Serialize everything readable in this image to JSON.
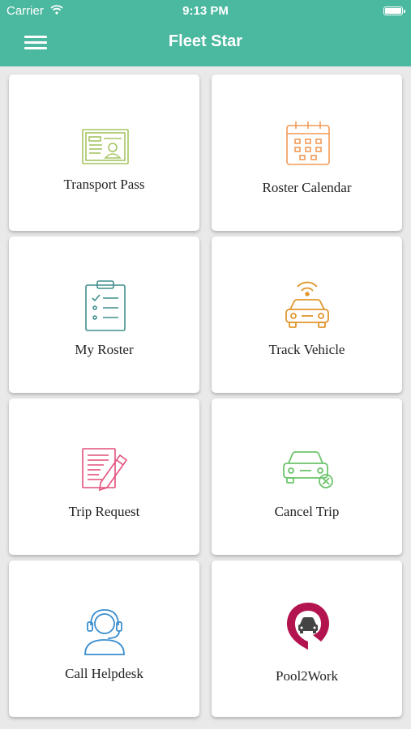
{
  "status_bar": {
    "carrier": "Carrier",
    "time": "9:13 PM"
  },
  "nav": {
    "title": "Fleet Star",
    "menu_icon": "hamburger-menu-icon"
  },
  "tiles": [
    {
      "label": "Transport Pass",
      "icon": "id-card-icon",
      "color": "#a5c563"
    },
    {
      "label": "Roster Calendar",
      "icon": "calendar-icon",
      "color": "#f29a56"
    },
    {
      "label": "My Roster",
      "icon": "clipboard-checklist-icon",
      "color": "#3f8f8c"
    },
    {
      "label": "Track Vehicle",
      "icon": "car-signal-icon",
      "color": "#e0962c"
    },
    {
      "label": "Trip Request",
      "icon": "document-pencil-icon",
      "color": "#e2507a"
    },
    {
      "label": "Cancel Trip",
      "icon": "car-cancel-icon",
      "color": "#6cc46c"
    },
    {
      "label": "Call Helpdesk",
      "icon": "headset-agent-icon",
      "color": "#3a8ecf"
    },
    {
      "label": "Pool2Work",
      "icon": "pool2work-logo-icon",
      "color": "#b3144f"
    }
  ]
}
